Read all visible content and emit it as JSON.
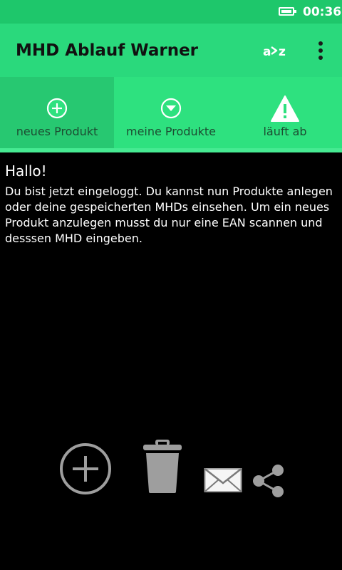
{
  "status_bar": {
    "time": "00:36",
    "battery_icon": "battery-full-icon",
    "background": "#1ec76b"
  },
  "app_bar": {
    "title": "MHD Ablauf Warner",
    "sort_icon": "sort-az-icon",
    "menu_icon": "more-vert-icon",
    "background": "#2ad97c"
  },
  "tabs": [
    {
      "label": "neues Produkt",
      "icon": "add-circle-icon",
      "active": true
    },
    {
      "label": "meine Produkte",
      "icon": "chevron-down-circle-icon",
      "active": false
    },
    {
      "label": "läuft ab",
      "icon": "warning-icon",
      "active": false
    }
  ],
  "main": {
    "greeting": "Hallo!",
    "message": "Du bist jetzt eingeloggt. Du kannst nun Produkte anlegen oder deine gespeicherten MHDs einsehen. Um ein neues Produkt anzulegen musst du nur eine EAN scannen und desssen MHD eingeben."
  },
  "actions": [
    {
      "icon": "add-circle-outline-icon"
    },
    {
      "icon": "trash-icon"
    },
    {
      "icon": "mail-icon"
    },
    {
      "icon": "share-icon"
    }
  ],
  "colors": {
    "accent": "#2ee17f",
    "tab_active": "#27c871",
    "icon_gray": "#9e9e9e"
  }
}
